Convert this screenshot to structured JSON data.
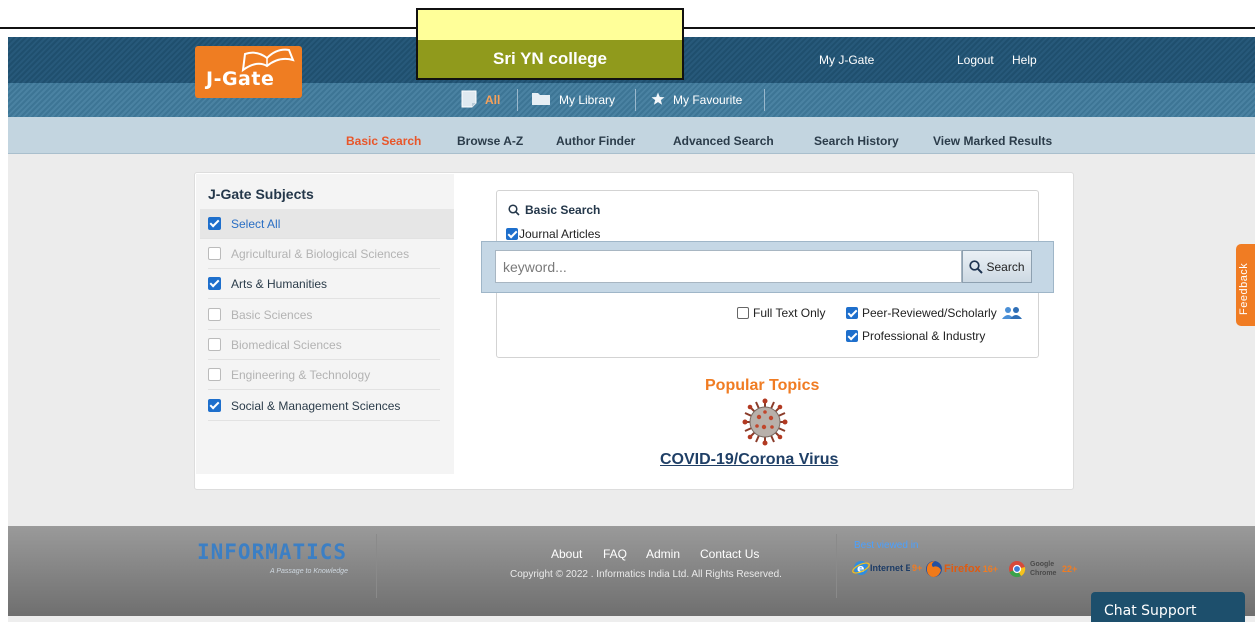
{
  "header": {
    "logo_text": "J-Gate",
    "college_name": "Sri YN college",
    "links": {
      "my_jgate": "My J-Gate",
      "logout": "Logout",
      "help": "Help"
    }
  },
  "nav": {
    "tabs": [
      {
        "label": "All",
        "icon": "document-icon",
        "active": true
      },
      {
        "label": "My Library",
        "icon": "folder-icon",
        "active": false
      },
      {
        "label": "My Favourite",
        "icon": "star-icon",
        "active": false
      }
    ]
  },
  "subnav": {
    "items": [
      {
        "label": "Basic Search",
        "active": true
      },
      {
        "label": "Browse A-Z",
        "active": false
      },
      {
        "label": "Author Finder",
        "active": false
      },
      {
        "label": "Advanced Search",
        "active": false
      },
      {
        "label": "Search History",
        "active": false
      },
      {
        "label": "View Marked Results",
        "active": false
      }
    ]
  },
  "subjects": {
    "title": "J-Gate Subjects",
    "items": [
      {
        "label": "Select All",
        "checked": true,
        "enabled": true
      },
      {
        "label": "Agricultural & Biological Sciences",
        "checked": false,
        "enabled": false
      },
      {
        "label": "Arts & Humanities",
        "checked": true,
        "enabled": true
      },
      {
        "label": "Basic Sciences",
        "checked": false,
        "enabled": false
      },
      {
        "label": "Biomedical Sciences",
        "checked": false,
        "enabled": false
      },
      {
        "label": "Engineering & Technology",
        "checked": false,
        "enabled": false
      },
      {
        "label": "Social & Management Sciences",
        "checked": true,
        "enabled": true
      }
    ]
  },
  "search": {
    "title": "Basic Search",
    "journal_articles_label": "Journal Articles",
    "journal_articles_checked": true,
    "placeholder": "keyword...",
    "value": "",
    "button_label": "Search",
    "options": {
      "full_text_only": {
        "label": "Full Text Only",
        "checked": false
      },
      "peer_reviewed": {
        "label": "Peer-Reviewed/Scholarly",
        "checked": true
      },
      "professional": {
        "label": "Professional & Industry",
        "checked": true
      }
    }
  },
  "popular": {
    "title": "Popular Topics",
    "topic_link": "COVID-19/Corona Virus"
  },
  "footer": {
    "logo_text": "INFORMATICS",
    "tagline": "A Passage to Knowledge",
    "links": [
      "About",
      "FAQ",
      "Admin",
      "Contact Us"
    ],
    "copyright": "Copyright © 2022 . Informatics India Ltd. All Rights Reserved.",
    "best_viewed": "Best viewed in",
    "browsers": [
      {
        "name": "Internet Explorer",
        "version": "9+"
      },
      {
        "name": "Firefox",
        "version": "16+"
      },
      {
        "name": "Google Chrome",
        "version": "22+"
      }
    ]
  },
  "widgets": {
    "feedback": "Feedback",
    "chat_support": "Chat Support"
  },
  "colors": {
    "header_dark": "#1f4f6e",
    "accent_orange": "#f07c23",
    "college_bar": "#909a1c",
    "checkbox_blue": "#1e6fcc"
  }
}
